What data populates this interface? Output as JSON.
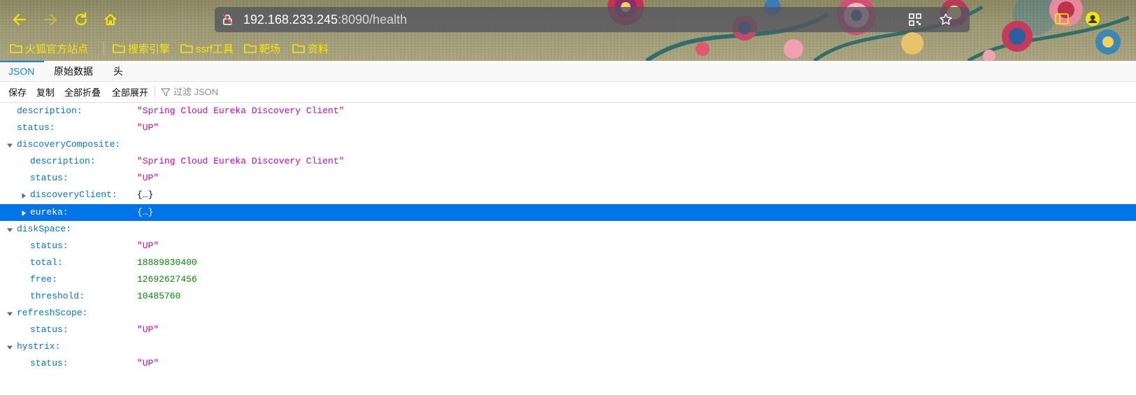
{
  "browser": {
    "url_host": "192.168.233.245",
    "url_rest": ":8090/health",
    "bookmarks": [
      "火狐官方站点",
      "搜索引擎",
      "ssrf工具",
      "靶场",
      "资料"
    ]
  },
  "viewer": {
    "tabs": [
      "JSON",
      "原始数据",
      "头"
    ],
    "toolbar": {
      "save": "保存",
      "copy": "复制",
      "collapse_all": "全部折叠",
      "expand_all": "全部展开",
      "filter_placeholder": "过滤 JSON"
    }
  },
  "tree": {
    "rows": [
      {
        "key": "description:",
        "value": "\"Spring Cloud Eureka Discovery Client\""
      },
      {
        "key": "status:",
        "value": "\"UP\""
      },
      {
        "key": "discoveryComposite:",
        "value": ""
      },
      {
        "key": "description:",
        "value": "\"Spring Cloud Eureka Discovery Client\""
      },
      {
        "key": "status:",
        "value": "\"UP\""
      },
      {
        "key": "discoveryClient:",
        "value": "{…}"
      },
      {
        "key": "eureka:",
        "value": "{…}"
      },
      {
        "key": "diskSpace:",
        "value": ""
      },
      {
        "key": "status:",
        "value": "\"UP\""
      },
      {
        "key": "total:",
        "value": "18889830400"
      },
      {
        "key": "free:",
        "value": "12692627456"
      },
      {
        "key": "threshold:",
        "value": "10485760"
      },
      {
        "key": "refreshScope:",
        "value": ""
      },
      {
        "key": "status:",
        "value": "\"UP\""
      },
      {
        "key": "hystrix:",
        "value": ""
      },
      {
        "key": "status:",
        "value": "\"UP\""
      }
    ]
  },
  "colors": {
    "accent": "#0a84ff",
    "selected_row": "#0074e8",
    "key": "#0074e8",
    "string": "#dd00a9",
    "number": "#058b00",
    "chrome_icon": "#f5e800"
  }
}
